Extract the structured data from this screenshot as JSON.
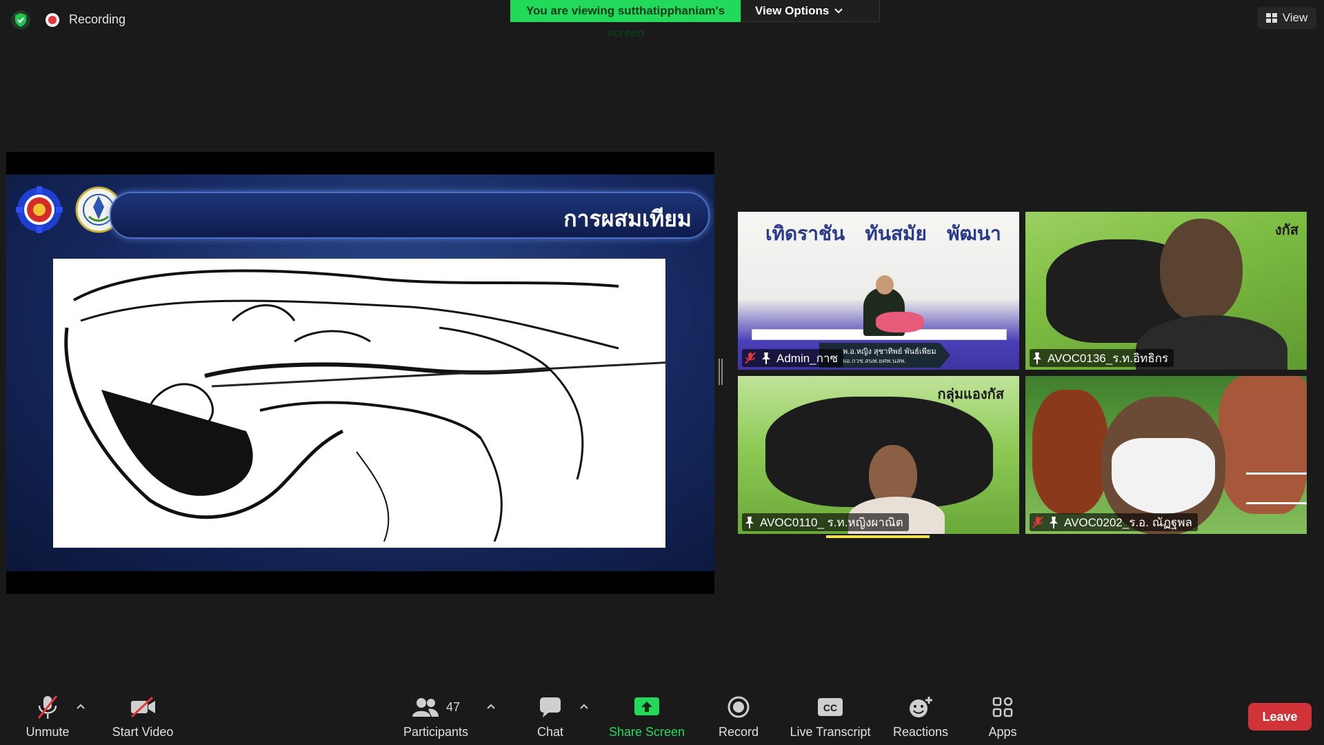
{
  "top": {
    "recording_label": "Recording",
    "banner_text": "You are viewing sutthatipphaniam's screen",
    "view_options_label": "View Options",
    "view_label": "View"
  },
  "slide": {
    "title": "การผสมเทียม"
  },
  "gallery": [
    {
      "name": "Admin_กาซ",
      "muted": true,
      "overlay_text": "เทิดราชัน   ทันสมัย   พัฒนา",
      "caption_line1": "พ.อ.หญิง สุชาทิพย์ พันธ์เพียม",
      "caption_line2": "ผอ.กวช.สนพ.ยศพ.นสพ."
    },
    {
      "name": "AVOC0136_ร.ท.อิทธิกร",
      "muted": false,
      "overlay_text": "งกัส"
    },
    {
      "name": "AVOC0110_ ร.ท.หญิงผาณิต",
      "muted": false,
      "overlay_text": "กลุ่มแองกัส"
    },
    {
      "name": "AVOC0202_ร.อ. ณัฏฐพล",
      "muted": true
    }
  ],
  "toolbar": {
    "unmute": "Unmute",
    "start_video": "Start Video",
    "participants": "Participants",
    "participants_count": "47",
    "chat": "Chat",
    "share_screen": "Share Screen",
    "record": "Record",
    "live_transcript": "Live Transcript",
    "reactions": "Reactions",
    "apps": "Apps",
    "leave": "Leave"
  },
  "colors": {
    "banner_green": "#23d959",
    "leave_red": "#d13438",
    "muted_red": "#e0383e",
    "speaking_yellow": "#f3e14a"
  }
}
